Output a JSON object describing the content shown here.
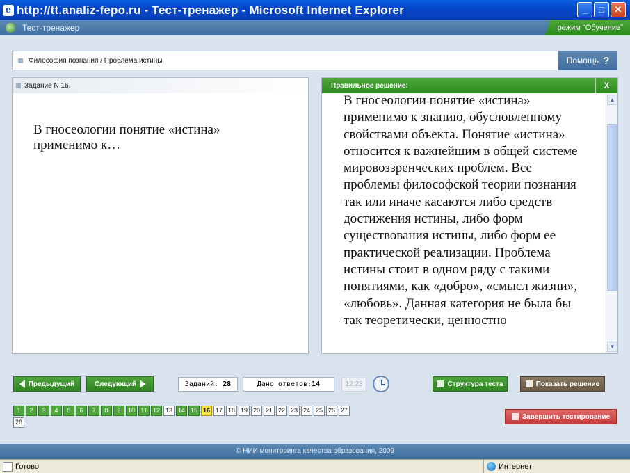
{
  "window": {
    "title": "http://tt.analiz-fepo.ru - Тест-тренажер - Microsoft Internet Explorer",
    "minimize": "_",
    "maximize": "□",
    "close": "✕"
  },
  "app": {
    "title": "Тест-тренажер",
    "mode": "режим \"Обучение\""
  },
  "breadcrumb": "Философия познания / Проблема истины",
  "help": {
    "label": "Помощь",
    "icon": "?"
  },
  "task": {
    "header": "Задание N 16.",
    "question": "В гносеологии  понятие «истина» применимо к…"
  },
  "solution": {
    "header": "Правильное решение:",
    "close": "X",
    "text": "В гносеологии понятие «истина»  применимо к знанию, обусловленному свойствами объекта. Понятие «истина»  относится к важнейшим в общей системе мировоззренческих проблем. Все проблемы философской теории познания так или иначе касаются либо средств достижения истины, либо форм существования истины, либо форм ее практической реализации. Проблема истины стоит в одном ряду с такими понятиями, как «добро», «смысл жизни», «любовь». Данная категория не была бы так теоретически, ценностно"
  },
  "toolbar": {
    "prev": "Предыдущий",
    "next": "Следующий",
    "tasks_label": "Заданий:",
    "tasks_value": "28",
    "answers_label": "Дано ответов:",
    "answers_value": "14",
    "time": "12:23",
    "structure": "Структура теста",
    "show_solution": "Показать решение",
    "finish": "Завершить тестирование"
  },
  "questions": [
    {
      "n": "1",
      "s": "answered"
    },
    {
      "n": "2",
      "s": "answered"
    },
    {
      "n": "3",
      "s": "answered"
    },
    {
      "n": "4",
      "s": "answered"
    },
    {
      "n": "5",
      "s": "answered"
    },
    {
      "n": "6",
      "s": "answered"
    },
    {
      "n": "7",
      "s": "answered"
    },
    {
      "n": "8",
      "s": "answered"
    },
    {
      "n": "9",
      "s": "answered"
    },
    {
      "n": "10",
      "s": "answered"
    },
    {
      "n": "11",
      "s": "answered"
    },
    {
      "n": "12",
      "s": "answered"
    },
    {
      "n": "13",
      "s": "none"
    },
    {
      "n": "14",
      "s": "answered"
    },
    {
      "n": "15",
      "s": "answered"
    },
    {
      "n": "16",
      "s": "current"
    },
    {
      "n": "17",
      "s": "none"
    },
    {
      "n": "18",
      "s": "none"
    },
    {
      "n": "19",
      "s": "none"
    },
    {
      "n": "20",
      "s": "none"
    },
    {
      "n": "21",
      "s": "none"
    },
    {
      "n": "22",
      "s": "none"
    },
    {
      "n": "23",
      "s": "none"
    },
    {
      "n": "24",
      "s": "none"
    },
    {
      "n": "25",
      "s": "none"
    },
    {
      "n": "26",
      "s": "none"
    },
    {
      "n": "27",
      "s": "none"
    },
    {
      "n": "28",
      "s": "none"
    }
  ],
  "footer": "© НИИ мониторинга качества образования, 2009",
  "status": {
    "left": "Готово",
    "zone": "Интернет"
  },
  "colors": {
    "answered": "#4fa63c",
    "current": "#f5e23a",
    "accent_blue": "#406e9e"
  }
}
